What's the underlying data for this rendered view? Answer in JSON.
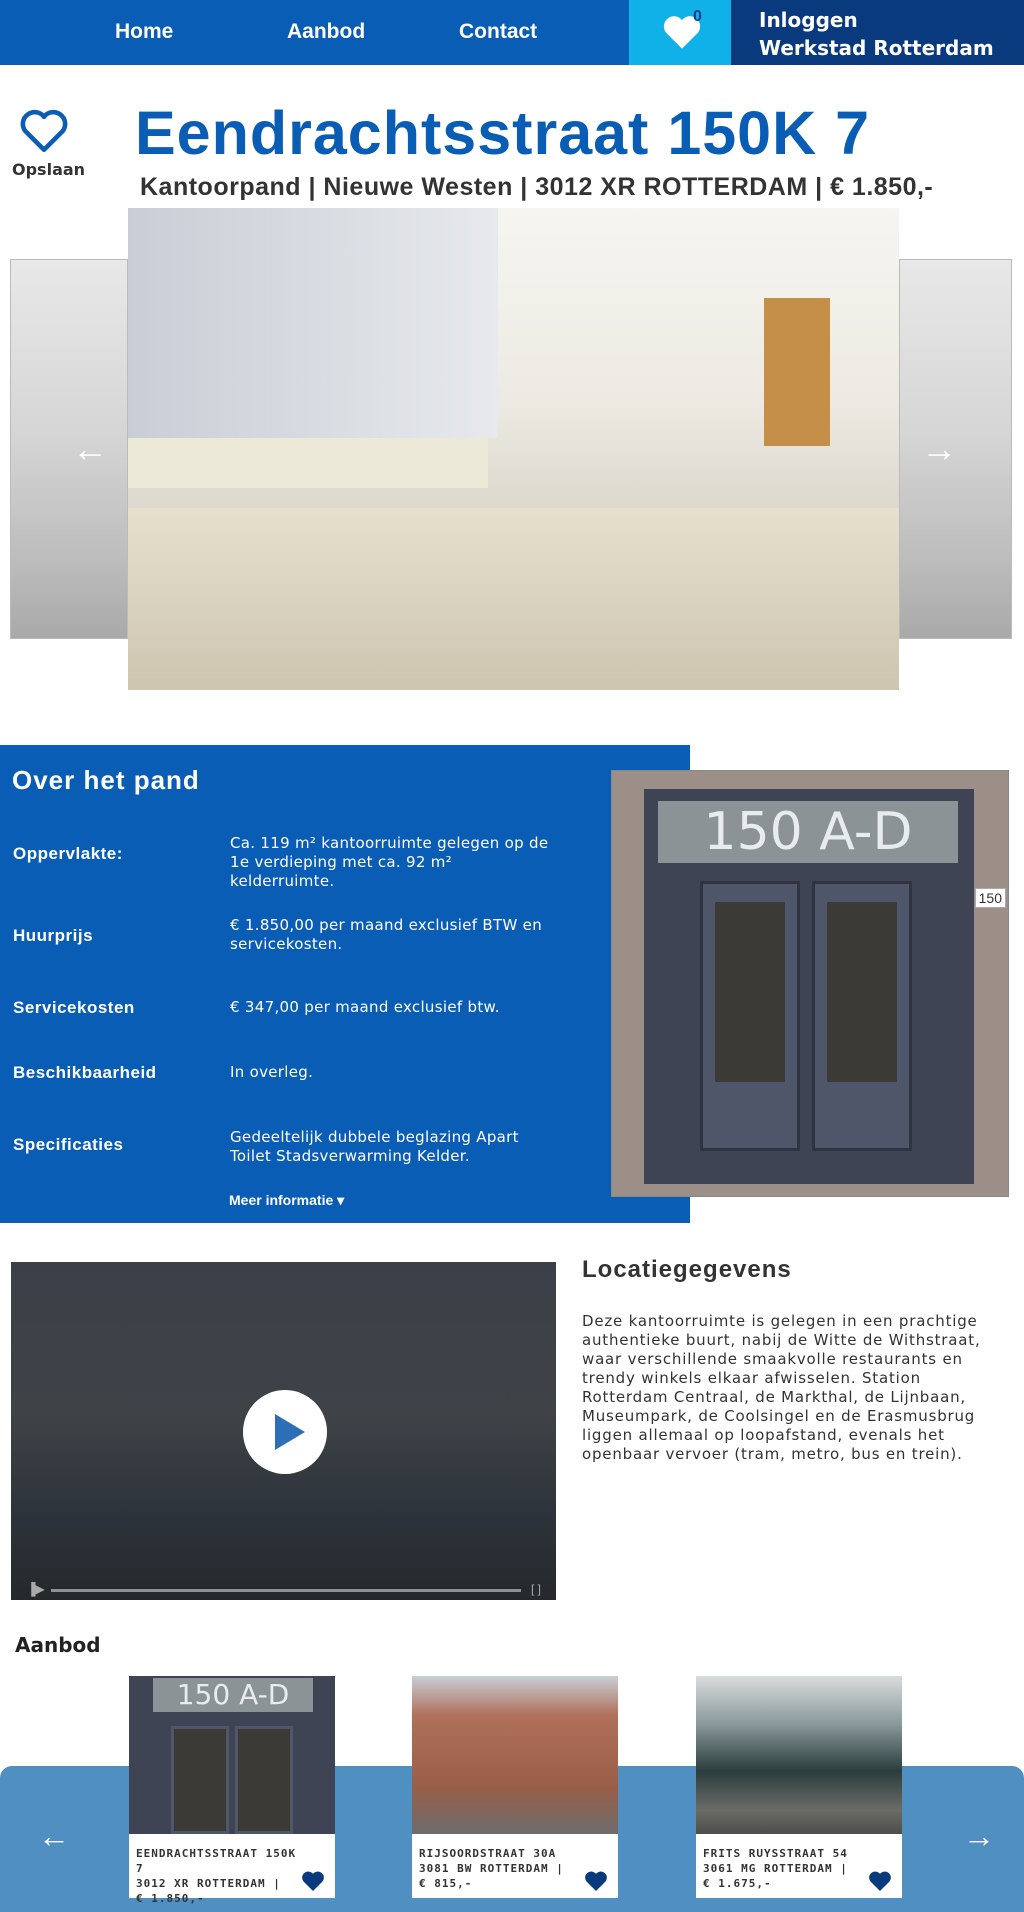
{
  "nav": {
    "links": [
      "Home",
      "Aanbod",
      "Contact"
    ],
    "favorites_count": "0",
    "login_line1": "Inloggen",
    "login_line2": "Werkstad Rotterdam"
  },
  "save": {
    "label": "Opslaan"
  },
  "property": {
    "title": "Eendrachtsstraat 150K 7",
    "subtitle": "Kantoorpand | Nieuwe Westen | 3012 XR ROTTERDAM | € 1.850,-"
  },
  "carousel": {
    "slide_count": 5,
    "active_index": 1,
    "prev_icon": "arrow-left-icon",
    "next_icon": "arrow-right-icon"
  },
  "about": {
    "title": "Over het pand",
    "specs": [
      {
        "label": "Oppervlakte:",
        "value": "Ca. 119 m² kantoorruimte gelegen op de 1e verdieping met ca. 92 m² kelderruimte."
      },
      {
        "label": "Huurprijs",
        "value": "€ 1.850,00 per maand exclusief BTW en servicekosten."
      },
      {
        "label": "Servicekosten",
        "value": "€ 347,00 per maand exclusief btw."
      },
      {
        "label": "Beschikbaarheid",
        "value": "In overleg."
      },
      {
        "label": "Specificaties",
        "value": "Gedeeltelijk dubbele beglazing  Apart Toilet  Stadsverwarming  Kelder."
      }
    ],
    "more_label": "Meer informatie",
    "door_sign": "150 A-D",
    "house_number": "150"
  },
  "location": {
    "title": "Locatiegegevens",
    "text": "Deze kantoorruimte is gelegen in een prachtige authentieke buurt, nabij de Witte de Withstraat, waar verschillende smaakvolle restaurants en trendy winkels elkaar afwisselen. Station Rotterdam Centraal, de Markthal, de Lijnbaan, Museumpark, de Coolsingel en de Erasmusbrug liggen allemaal op loopafstand, evenals het openbaar vervoer (tram, metro, bus en trein)."
  },
  "aanbod": {
    "title": "Aanbod",
    "cards": [
      {
        "line1": "EENDRACHTSSTRAAT 150K 7",
        "line2": "3012 XR ROTTERDAM |",
        "line3": "€ 1.850,-",
        "sign": "150 A-D"
      },
      {
        "line1": "RIJSOORDSTRAAT 30A",
        "line2": "3081 BW ROTTERDAM |",
        "line3": "€ 815,-"
      },
      {
        "line1": "FRITS RUYSSTRAAT 54",
        "line2": "3061 MG ROTTERDAM |",
        "line3": "€ 1.675,-"
      }
    ]
  },
  "colors": {
    "primary": "#0a5db5",
    "dark": "#0a3a7e",
    "accent": "#10b0e8",
    "band": "#4f8fc2"
  }
}
